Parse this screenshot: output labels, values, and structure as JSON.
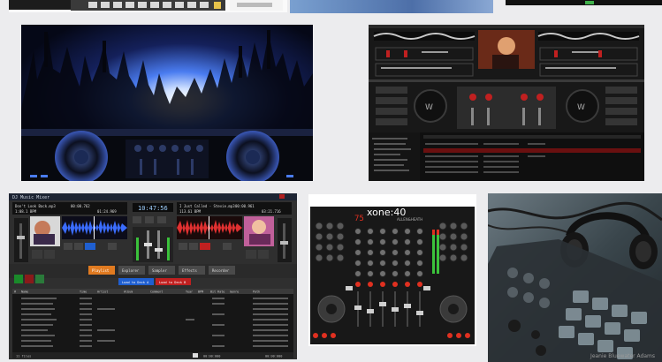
{
  "gallery": {
    "background": "#ececee",
    "tiles": [
      {
        "id": "top-left-partial",
        "label": "",
        "colors": {
          "bg": "#2a2a2a",
          "accent": "#e6c24a"
        }
      },
      {
        "id": "top-middle-partial",
        "label": "",
        "colors": {
          "bg": "#5c82b8"
        }
      },
      {
        "id": "top-right-partial",
        "label": "",
        "colors": {
          "bg": "#111111"
        }
      },
      {
        "id": "club-dj-decks",
        "label": "",
        "colors": {
          "bg": "#0a0e22",
          "accent": "#3a78ff"
        }
      },
      {
        "id": "dark-dj-software",
        "label": "",
        "colors": {
          "bg": "#1a1a1a",
          "accent": "#c02020"
        }
      },
      {
        "id": "dj-music-mixer",
        "label": "",
        "colors": {
          "bg": "#2b2b2b",
          "accent": "#d24a1a"
        }
      },
      {
        "id": "xone-mixer",
        "label": "",
        "colors": {
          "bg": "#121212",
          "accent": "#e03020"
        }
      },
      {
        "id": "dj-controller-headphones",
        "label": "",
        "colors": {
          "bg": "#3c4a52"
        }
      }
    ]
  },
  "mixer_app": {
    "title": "DJ Music Mixer",
    "deck_a": {
      "track": "Don't Look Back.mp3",
      "bpm": "1:08.1 BPM",
      "elapsed": "00:00.762",
      "remain": "01:24.969"
    },
    "deck_b": {
      "track": "I Just Called - Stevie.mp3",
      "bpm": "113.61 BPM",
      "elapsed": "00:00.961",
      "remain": "03:21.716"
    },
    "clock": "10:47:56",
    "buttons": [
      "Playlist",
      "Explorer",
      "Sampler",
      "Effects",
      "Recorder"
    ],
    "panels": [
      "Load to Deck A",
      "Load to Deck B"
    ],
    "columns": [
      "#",
      "Name",
      "Time",
      "Artist",
      "Album",
      "Comment",
      "Year",
      "BPM",
      "Bit Rate",
      "Genre",
      "Path"
    ],
    "footer": "11 files",
    "time_left": "00:00:000",
    "time_right": "00:00:000"
  },
  "xone": {
    "brand": "xone:40",
    "maker": "ALLEN&HEATH"
  },
  "controller": {
    "caption": "Jeanie Bluewater Adams"
  }
}
